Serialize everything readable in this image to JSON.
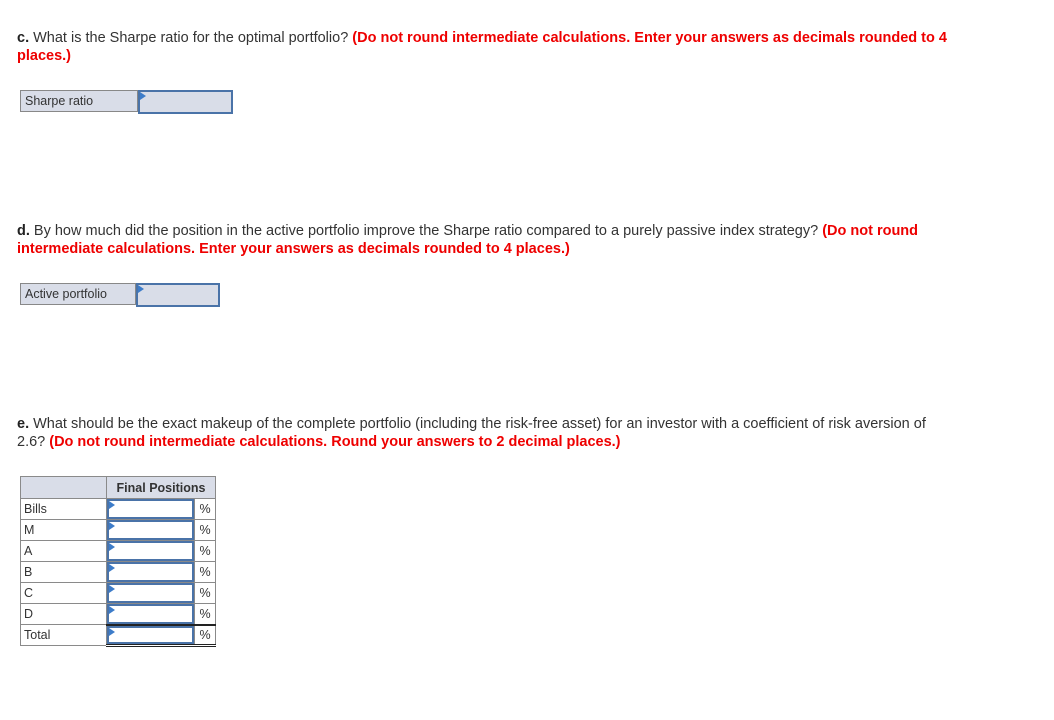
{
  "questions": {
    "c": {
      "part": "c.",
      "text": " What is the Sharpe ratio for the optimal portfolio? ",
      "instruction": "(Do not round intermediate calculations. Enter your answers as decimals rounded to 4 places.)",
      "answer_label": "Sharpe ratio",
      "answer_value": ""
    },
    "d": {
      "part": "d.",
      "text": " By how much did the position in the active portfolio improve the Sharpe ratio compared to a purely passive index strategy? ",
      "instruction": "(Do not round intermediate calculations. Enter your answers as decimals rounded to 4 places.)",
      "answer_label": "Active portfolio",
      "answer_value": ""
    },
    "e": {
      "part": "e.",
      "text": " What should be the exact makeup of the complete portfolio (including the risk-free asset) for an investor with a coefficient of risk aversion of 2.6? ",
      "instruction": "(Do not round intermediate calculations. Round your answers to 2 decimal places.)",
      "table": {
        "header": "Final Positions",
        "unit": "%",
        "rows": [
          {
            "label": "Bills",
            "value": ""
          },
          {
            "label": "M",
            "value": ""
          },
          {
            "label": "A",
            "value": ""
          },
          {
            "label": "B",
            "value": ""
          },
          {
            "label": "C",
            "value": ""
          },
          {
            "label": "D",
            "value": ""
          },
          {
            "label": "Total",
            "value": ""
          }
        ]
      }
    }
  },
  "colors": {
    "instruction_red": "#ee0000",
    "input_border_blue": "#4a73a8",
    "flag_blue": "#3d7cc9",
    "label_bg": "#d9dde8"
  }
}
